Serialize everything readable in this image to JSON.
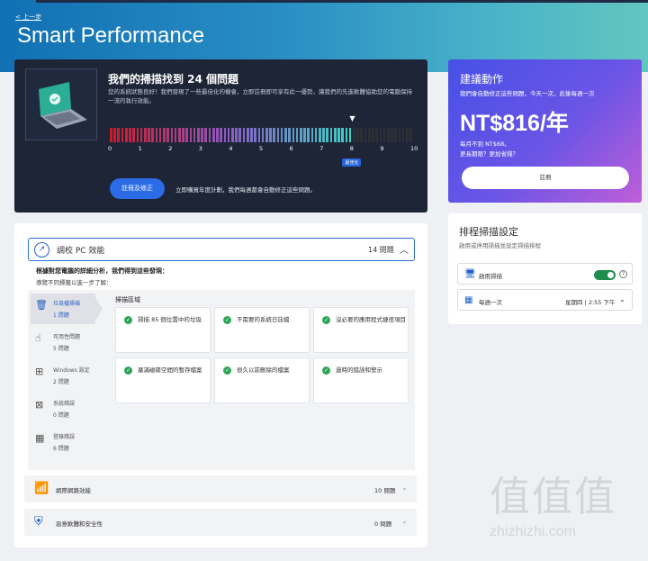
{
  "header": {
    "back": "< 上一步",
    "title": "Smart Performance"
  },
  "scan": {
    "title": "我們的掃描找到 24 個問題",
    "description": "您的系統狀態良好！我們發現了一些最佳化的機會，立即註冊即可享有此一優勢，讓我們的先進軟體協助您的電腦保持一流的執行效能。",
    "ticks": [
      "0",
      "1",
      "2",
      "3",
      "4",
      "5",
      "6",
      "7",
      "8",
      "9",
      "10"
    ],
    "score": 8,
    "best_badge": "最佳化",
    "register_button": "註冊及修正",
    "register_note": "立即購買年度計劃，我們每週都會自動修正這些問題。"
  },
  "recommend": {
    "title": "建議動作",
    "subtitle": "我們會自動修正這些問題，今天一次，此後每週一次",
    "price": "NT$816/年",
    "monthly": "每月不到 NT$68。",
    "longer": "更長期限？更加省錢？",
    "button": "註冊"
  },
  "schedule": {
    "title": "排程掃描設定",
    "subtitle": "啟用或停用掃描並設定掃描排程",
    "enable_label": "啟用掃描",
    "enabled": true,
    "frequency_label": "每週一次",
    "when": "星期四 | 2:55 下午"
  },
  "pc": {
    "label": "調校 PC 效能",
    "count": "14 問題",
    "found": "根據對您電腦的詳細分析，我們得到這些發現：",
    "guide": "導覽不同標籤以進一步了解：",
    "area_title": "掃描區域",
    "categories": [
      {
        "name": "垃圾檔掃描",
        "count": "1 問題"
      },
      {
        "name": "可用性問題",
        "count": "5 問題"
      },
      {
        "name": "Windows 設定",
        "count": "2 問題"
      },
      {
        "name": "系統錯誤",
        "count": "0 問題"
      },
      {
        "name": "登錄錯誤",
        "count": "6 問題"
      }
    ],
    "tiles": [
      "掃描 85 個位置中的垃圾",
      "不需要的系統日誌檔",
      "沒必要的應用程式捷徑項目",
      "塞滿磁碟空間的暫存檔案",
      "很久以前刪除的檔案",
      "過時的錯誤和警示"
    ]
  },
  "network": {
    "label": "網際網路效能",
    "count": "10 問題"
  },
  "security": {
    "label": "惡意軟體和安全性",
    "count": "0 問題"
  },
  "watermark": {
    "big": "值值值",
    "small": "zhizhizhi.com"
  },
  "colors": {
    "bar_gradient_start": "#d01a2a",
    "bar_gradient_mid": "#8b5cc6",
    "bar_gradient_end": "#3fd0c4",
    "accent": "#2b6be6",
    "toggle": "#1e8e4e"
  }
}
